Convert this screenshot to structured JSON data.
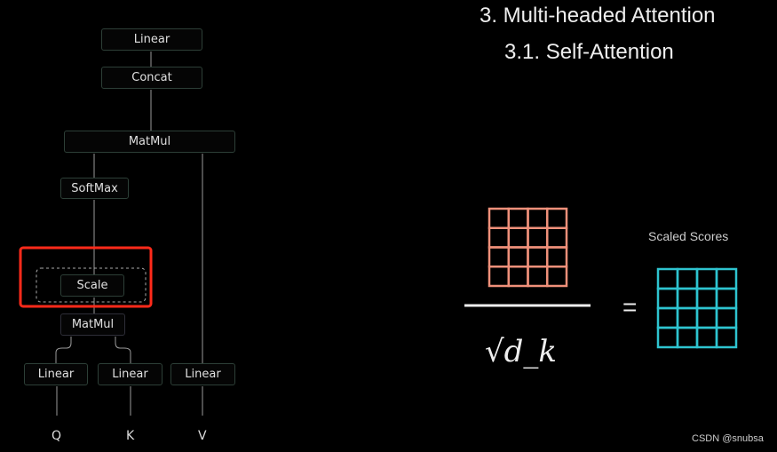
{
  "title": "3. Multi-headed Attention",
  "subtitle": "3.1. Self-Attention",
  "diagram": {
    "linear_out": "Linear",
    "concat": "Concat",
    "matmul_top": "MatMul",
    "softmax": "SoftMax",
    "scale": "Scale",
    "matmul_bottom": "MatMul",
    "linear_q": "Linear",
    "linear_k": "Linear",
    "linear_v": "Linear",
    "inputs": [
      "Q",
      "K",
      "V"
    ],
    "highlight_color": "#ff2a1a"
  },
  "formula": {
    "denominator": "√d_k",
    "equals": "=",
    "result_label": "Scaled Scores",
    "numerator_color": "#f0907a",
    "result_color": "#2ec4d0",
    "grid_size": 4
  },
  "watermark": "CSDN @snubsa"
}
